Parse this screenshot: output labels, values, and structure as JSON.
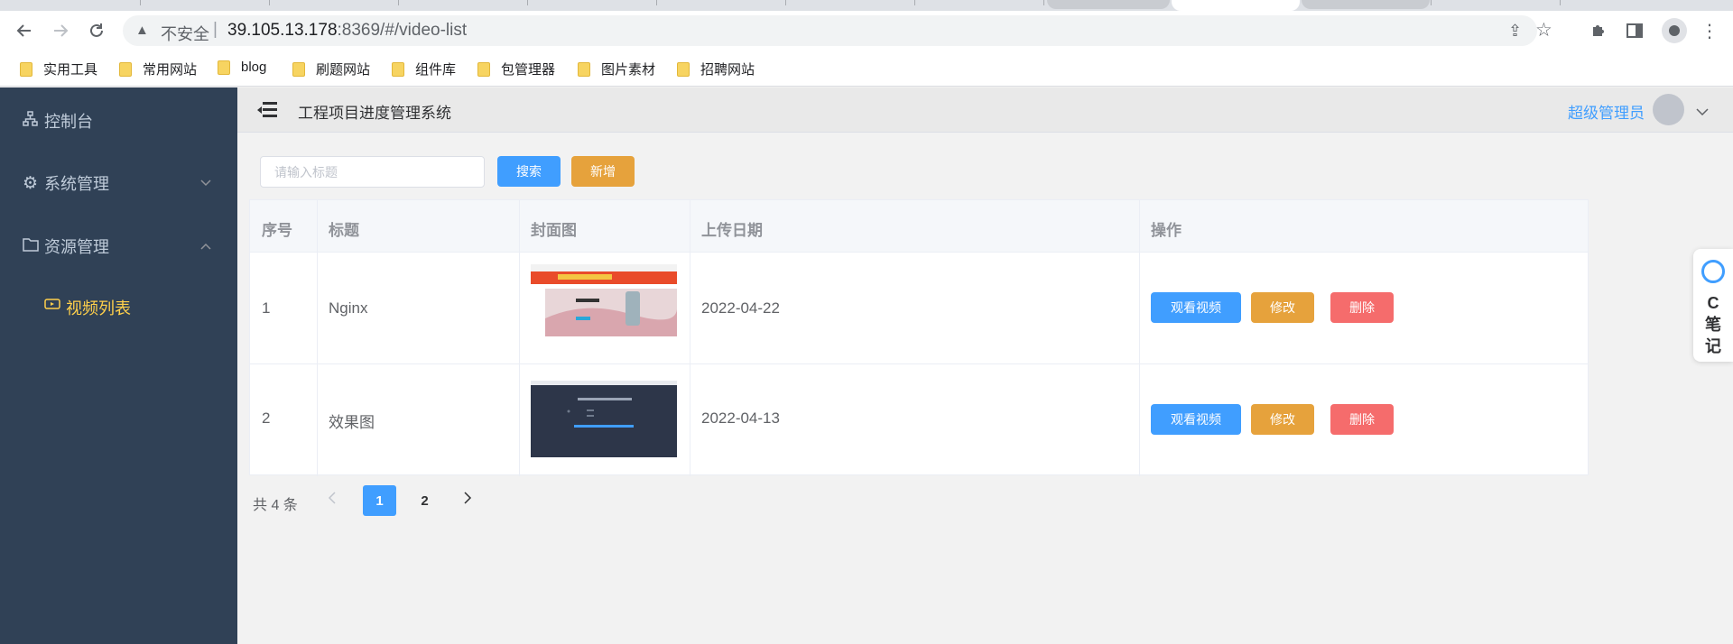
{
  "browser": {
    "insecure_label": "不安全",
    "url_host": "39.105.13.178",
    "url_rest": ":8369/#/video-list",
    "bookmarks": [
      {
        "label": "实用工具"
      },
      {
        "label": "常用网站"
      },
      {
        "label": "blog"
      },
      {
        "label": "刷题网站"
      },
      {
        "label": "组件库"
      },
      {
        "label": "包管理器"
      },
      {
        "label": "图片素材"
      },
      {
        "label": "招聘网站"
      }
    ]
  },
  "sidebar": {
    "items": [
      {
        "label": "控制台",
        "icon": "sitemap-icon"
      },
      {
        "label": "系统管理",
        "icon": "gear-icon"
      },
      {
        "label": "资源管理",
        "icon": "folder-icon"
      }
    ],
    "sub_item": {
      "label": "视频列表",
      "icon": "video-icon"
    }
  },
  "header": {
    "title": "工程项目进度管理系统",
    "user": "超级管理员"
  },
  "toolbar": {
    "search_placeholder": "请输入标题",
    "search_label": "搜索",
    "add_label": "新增"
  },
  "table": {
    "columns": [
      "序号",
      "标题",
      "封面图",
      "上传日期",
      "操作"
    ],
    "rows": [
      {
        "index": "1",
        "title": "Nginx",
        "date": "2022-04-22"
      },
      {
        "index": "2",
        "title": "效果图",
        "date": "2022-04-13"
      }
    ],
    "actions": {
      "view": "观看视频",
      "edit": "修改",
      "delete": "删除"
    }
  },
  "pagination": {
    "total": "共 4 条",
    "pages": [
      "1",
      "2"
    ],
    "current": "1"
  },
  "float_note": {
    "text": "C笔记"
  },
  "colors": {
    "sidebar_bg": "#304156",
    "sidebar_active": "#ffd04b",
    "primary": "#409eff",
    "warning": "#e6a23c",
    "danger": "#f56c6c"
  }
}
